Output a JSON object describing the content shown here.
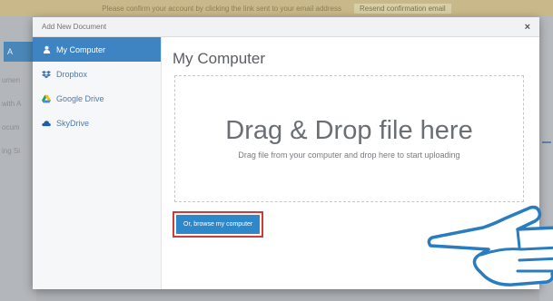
{
  "background": {
    "banner_text": "Please confirm your account by clicking the link sent to your email address",
    "banner_link": "Resend confirmation email",
    "sidebar_tab": "A",
    "sidebar_fragments": [
      "umen",
      "with A",
      "ocum",
      "ing Si"
    ]
  },
  "modal": {
    "title": "Add New Document",
    "close": "×"
  },
  "nav": {
    "items": [
      {
        "label": "My Computer",
        "icon": "user-icon",
        "active": true
      },
      {
        "label": "Dropbox",
        "icon": "dropbox-icon",
        "active": false
      },
      {
        "label": "Google Drive",
        "icon": "google-drive-icon",
        "active": false
      },
      {
        "label": "SkyDrive",
        "icon": "cloud-icon",
        "active": false
      }
    ]
  },
  "content": {
    "title": "My Computer",
    "drop_title": "Drag & Drop file here",
    "drop_subtitle": "Drag file from your computer and drop here to start uploading",
    "browse_button": "Or, browse my computer"
  },
  "colors": {
    "accent": "#3f84c2",
    "button": "#2d87c9",
    "highlight": "#d23a3a",
    "hand_outline": "#2a7cc0"
  }
}
